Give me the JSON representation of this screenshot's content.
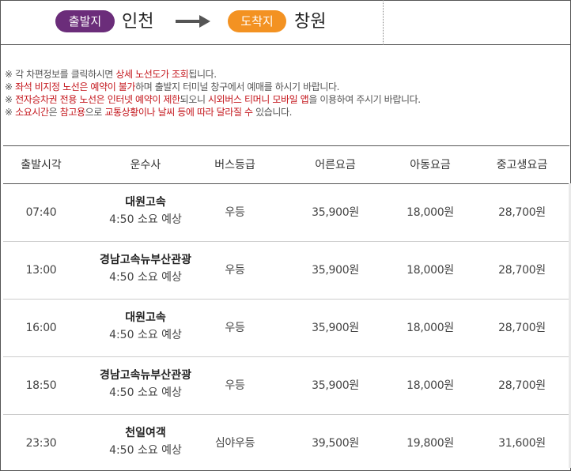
{
  "route": {
    "departure_label": "출발지",
    "departure_city": "인천",
    "arrival_label": "도착지",
    "arrival_city": "창원",
    "arrow_icon": "arrow-right-icon",
    "colors": {
      "departure_pill": "#6b2d7a",
      "arrival_pill": "#f39222",
      "highlight": "#c4161c"
    }
  },
  "notices": [
    {
      "mark": "※",
      "segments": [
        {
          "t": " 각 차편정보를 클릭하시면 ",
          "hl": false
        },
        {
          "t": "상세 노선도가 조회",
          "hl": true
        },
        {
          "t": "됩니다.",
          "hl": false
        }
      ]
    },
    {
      "mark": "※",
      "segments": [
        {
          "t": " 좌석 비지정 노선은 예약이 불가",
          "hl": true
        },
        {
          "t": "하며 출발지 터미널 창구에서 예매를 하시기 바랍니다.",
          "hl": false
        }
      ]
    },
    {
      "mark": "※",
      "segments": [
        {
          "t": " 전자승차권 전용 노선은 인터넷 예약이 제한",
          "hl": true
        },
        {
          "t": "되오니 ",
          "hl": false
        },
        {
          "t": "시외버스 티머니 모바일 앱",
          "hl": true
        },
        {
          "t": "을 이용하여 주시기 바랍니다.",
          "hl": false
        }
      ]
    },
    {
      "mark": "※",
      "segments": [
        {
          "t": " 소요시간",
          "hl": true
        },
        {
          "t": "은 ",
          "hl": false
        },
        {
          "t": "참고용",
          "hl": true
        },
        {
          "t": "으로 ",
          "hl": false
        },
        {
          "t": "교통상황이나 날씨 등에 따라 달라질 수",
          "hl": true
        },
        {
          "t": " 있습니다.",
          "hl": false
        }
      ]
    }
  ],
  "table": {
    "headers": {
      "time": "출발시각",
      "company": "운수사",
      "grade": "버스등급",
      "adult": "어른요금",
      "child": "아동요금",
      "student": "중고생요금"
    },
    "rows": [
      {
        "time": "07:40",
        "company": "대원고속",
        "duration": "4:50 소요 예상",
        "grade": "우등",
        "adult": "35,900원",
        "child": "18,000원",
        "student": "28,700원"
      },
      {
        "time": "13:00",
        "company": "경남고속뉴부산관광",
        "duration": "4:50 소요 예상",
        "grade": "우등",
        "adult": "35,900원",
        "child": "18,000원",
        "student": "28,700원"
      },
      {
        "time": "16:00",
        "company": "대원고속",
        "duration": "4:50 소요 예상",
        "grade": "우등",
        "adult": "35,900원",
        "child": "18,000원",
        "student": "28,700원"
      },
      {
        "time": "18:50",
        "company": "경남고속뉴부산관광",
        "duration": "4:50 소요 예상",
        "grade": "우등",
        "adult": "35,900원",
        "child": "18,000원",
        "student": "28,700원"
      },
      {
        "time": "23:30",
        "company": "천일여객",
        "duration": "4:50 소요 예상",
        "grade": "심야우등",
        "adult": "39,500원",
        "child": "19,800원",
        "student": "31,600원"
      }
    ]
  }
}
